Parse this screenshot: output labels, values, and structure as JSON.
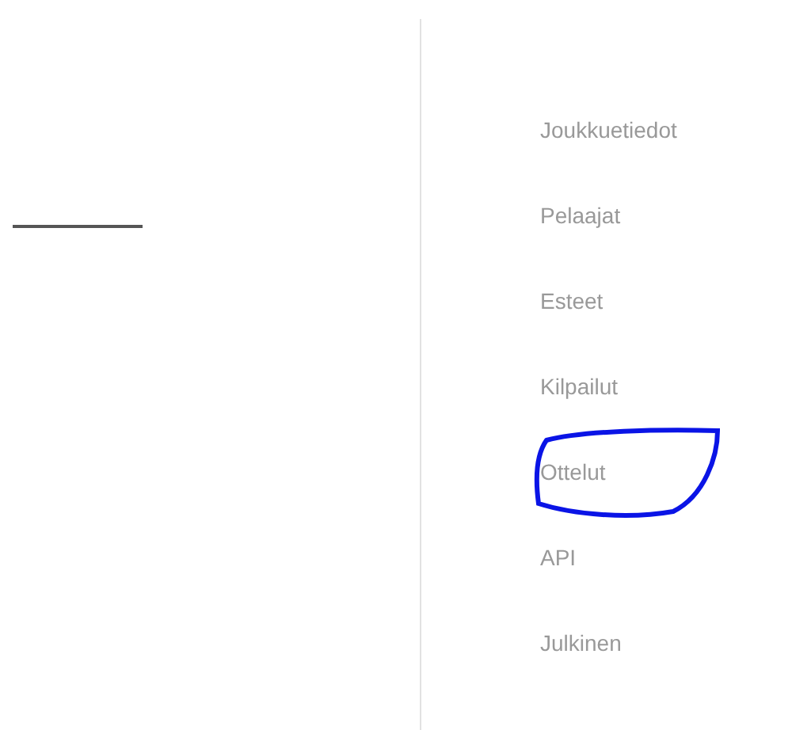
{
  "nav": {
    "items": [
      {
        "label": "Joukkuetiedot",
        "circled": false
      },
      {
        "label": "Pelaajat",
        "circled": false
      },
      {
        "label": "Esteet",
        "circled": false
      },
      {
        "label": "Kilpailut",
        "circled": false
      },
      {
        "label": "Ottelut",
        "circled": true
      },
      {
        "label": "API",
        "circled": false
      },
      {
        "label": "Julkinen",
        "circled": false
      }
    ]
  }
}
